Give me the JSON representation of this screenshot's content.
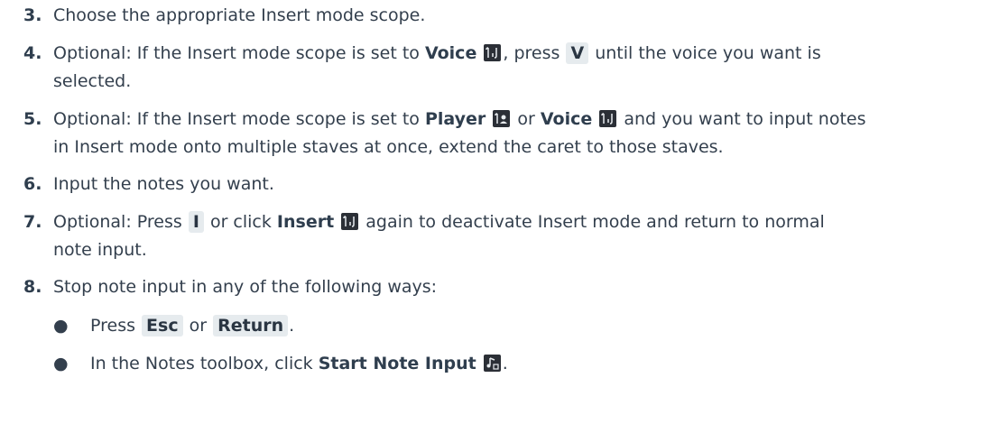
{
  "steps": [
    {
      "num": "3.",
      "text": "Choose the appropriate Insert mode scope."
    },
    {
      "num": "4.",
      "a": "Optional: If the Insert mode scope is set to ",
      "b1": "Voice",
      "c": ", press ",
      "key": "V",
      "d": " until the voice you want is",
      "line2": "selected."
    },
    {
      "num": "5.",
      "a": "Optional: If the Insert mode scope is set to ",
      "b1": "Player",
      "c": " or ",
      "b2": "Voice",
      "d": " and you want to input notes",
      "line2": "in Insert mode onto multiple staves at once, extend the caret to those staves."
    },
    {
      "num": "6.",
      "text": "Input the notes you want."
    },
    {
      "num": "7.",
      "a": "Optional: Press ",
      "key": "I",
      "c": " or click ",
      "b1": "Insert",
      "d": " again to deactivate Insert mode and return to normal",
      "line2": "note input."
    },
    {
      "num": "8.",
      "text": "Stop note input in any of the following ways:"
    }
  ],
  "bullets": [
    {
      "mark": "●",
      "a": "Press ",
      "key1": "Esc",
      "b": " or ",
      "key2": "Return",
      "c": "."
    },
    {
      "mark": "●",
      "a": "In the Notes toolbox, click ",
      "strong": "Start Note Input",
      "c": "."
    }
  ],
  "icons": [
    "voice-insert-icon",
    "player-insert-icon",
    "start-note-input-icon"
  ]
}
